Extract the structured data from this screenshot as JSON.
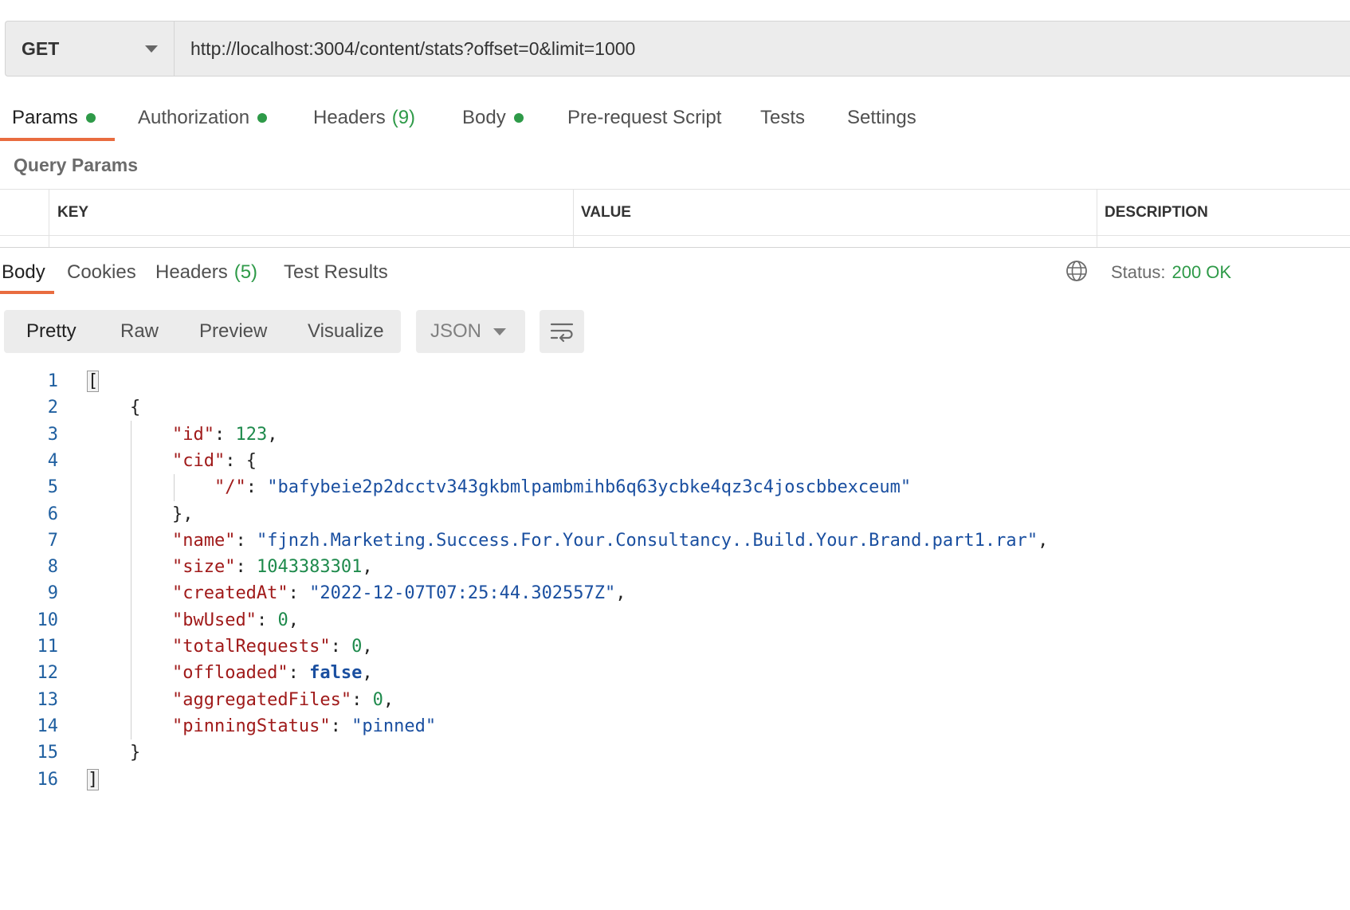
{
  "request": {
    "method": "GET",
    "url": "http://localhost:3004/content/stats?offset=0&limit=1000"
  },
  "request_tabs": [
    {
      "label": "Params",
      "dot": true,
      "count": ""
    },
    {
      "label": "Authorization",
      "dot": true,
      "count": ""
    },
    {
      "label": "Headers",
      "dot": false,
      "count": "(9)"
    },
    {
      "label": "Body",
      "dot": true,
      "count": ""
    },
    {
      "label": "Pre-request Script",
      "dot": false,
      "count": ""
    },
    {
      "label": "Tests",
      "dot": false,
      "count": ""
    },
    {
      "label": "Settings",
      "dot": false,
      "count": ""
    }
  ],
  "query_params": {
    "title": "Query Params",
    "columns": [
      "KEY",
      "VALUE",
      "DESCRIPTION"
    ]
  },
  "response_tabs": [
    {
      "label": "Body",
      "count": ""
    },
    {
      "label": "Cookies",
      "count": ""
    },
    {
      "label": "Headers",
      "count": "(5)"
    },
    {
      "label": "Test Results",
      "count": ""
    }
  ],
  "status": {
    "label": "Status:",
    "value": "200 OK"
  },
  "format_buttons": [
    "Pretty",
    "Raw",
    "Preview",
    "Visualize"
  ],
  "language": "JSON",
  "icons": {
    "globe": "globe-icon",
    "wrap": "wrap-lines-icon",
    "caret": "chevron-down-icon"
  },
  "colors": {
    "accent": "#e96c3f",
    "success": "#2e9a48",
    "json_key": "#a01a1a",
    "json_string": "#1a4fa0",
    "json_number": "#1e8a4c"
  },
  "code_lines": [
    [
      {
        "t": "p",
        "v": "["
      }
    ],
    [
      {
        "t": "p",
        "v": "    {"
      }
    ],
    [
      {
        "t": "p",
        "v": "        "
      },
      {
        "t": "k",
        "v": "\"id\""
      },
      {
        "t": "p",
        "v": ": "
      },
      {
        "t": "n",
        "v": "123"
      },
      {
        "t": "p",
        "v": ","
      }
    ],
    [
      {
        "t": "p",
        "v": "        "
      },
      {
        "t": "k",
        "v": "\"cid\""
      },
      {
        "t": "p",
        "v": ": {"
      }
    ],
    [
      {
        "t": "p",
        "v": "            "
      },
      {
        "t": "k",
        "v": "\"/\""
      },
      {
        "t": "p",
        "v": ": "
      },
      {
        "t": "s",
        "v": "\"bafybeie2p2dcctv343gkbmlpambmihb6q63ycbke4qz3c4joscbbexceum\""
      }
    ],
    [
      {
        "t": "p",
        "v": "        },"
      }
    ],
    [
      {
        "t": "p",
        "v": "        "
      },
      {
        "t": "k",
        "v": "\"name\""
      },
      {
        "t": "p",
        "v": ": "
      },
      {
        "t": "s",
        "v": "\"fjnzh.Marketing.Success.For.Your.Consultancy..Build.Your.Brand.part1.rar\""
      },
      {
        "t": "p",
        "v": ","
      }
    ],
    [
      {
        "t": "p",
        "v": "        "
      },
      {
        "t": "k",
        "v": "\"size\""
      },
      {
        "t": "p",
        "v": ": "
      },
      {
        "t": "n",
        "v": "1043383301"
      },
      {
        "t": "p",
        "v": ","
      }
    ],
    [
      {
        "t": "p",
        "v": "        "
      },
      {
        "t": "k",
        "v": "\"createdAt\""
      },
      {
        "t": "p",
        "v": ": "
      },
      {
        "t": "s",
        "v": "\"2022-12-07T07:25:44.302557Z\""
      },
      {
        "t": "p",
        "v": ","
      }
    ],
    [
      {
        "t": "p",
        "v": "        "
      },
      {
        "t": "k",
        "v": "\"bwUsed\""
      },
      {
        "t": "p",
        "v": ": "
      },
      {
        "t": "n",
        "v": "0"
      },
      {
        "t": "p",
        "v": ","
      }
    ],
    [
      {
        "t": "p",
        "v": "        "
      },
      {
        "t": "k",
        "v": "\"totalRequests\""
      },
      {
        "t": "p",
        "v": ": "
      },
      {
        "t": "n",
        "v": "0"
      },
      {
        "t": "p",
        "v": ","
      }
    ],
    [
      {
        "t": "p",
        "v": "        "
      },
      {
        "t": "k",
        "v": "\"offloaded\""
      },
      {
        "t": "p",
        "v": ": "
      },
      {
        "t": "b",
        "v": "false"
      },
      {
        "t": "p",
        "v": ","
      }
    ],
    [
      {
        "t": "p",
        "v": "        "
      },
      {
        "t": "k",
        "v": "\"aggregatedFiles\""
      },
      {
        "t": "p",
        "v": ": "
      },
      {
        "t": "n",
        "v": "0"
      },
      {
        "t": "p",
        "v": ","
      }
    ],
    [
      {
        "t": "p",
        "v": "        "
      },
      {
        "t": "k",
        "v": "\"pinningStatus\""
      },
      {
        "t": "p",
        "v": ": "
      },
      {
        "t": "s",
        "v": "\"pinned\""
      }
    ],
    [
      {
        "t": "p",
        "v": "    }"
      }
    ],
    [
      {
        "t": "p",
        "v": "]"
      }
    ]
  ]
}
